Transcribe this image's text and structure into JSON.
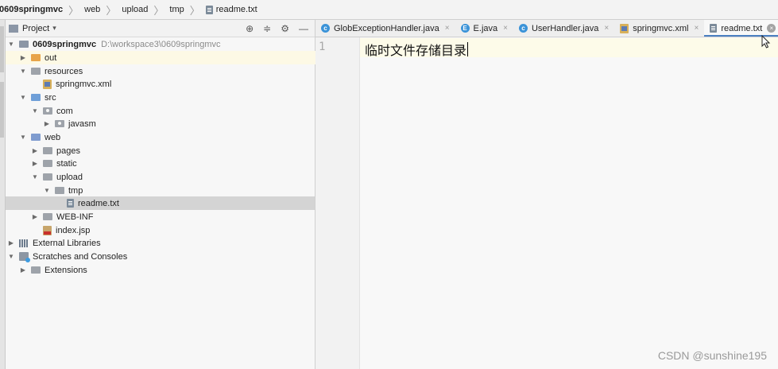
{
  "breadcrumb": [
    "0609springmvc",
    "web",
    "upload",
    "tmp",
    "readme.txt"
  ],
  "project_panel": {
    "title": "Project",
    "tree": [
      {
        "label": "0609springmvc",
        "path": "D:\\workspace3\\0609springmvc",
        "indent": 0,
        "expanded": true,
        "icon": "module-folder-icon",
        "bold": true
      },
      {
        "label": "out",
        "indent": 1,
        "expanded": false,
        "icon": "orange-folder-icon",
        "highlight": "yellow"
      },
      {
        "label": "resources",
        "indent": 1,
        "expanded": true,
        "icon": "resources-folder-icon"
      },
      {
        "label": "springmvc.xml",
        "indent": 2,
        "icon": "xml-file-icon"
      },
      {
        "label": "src",
        "indent": 1,
        "expanded": true,
        "icon": "source-folder-icon"
      },
      {
        "label": "com",
        "indent": 2,
        "expanded": true,
        "icon": "package-icon"
      },
      {
        "label": "javasm",
        "indent": 3,
        "expanded": false,
        "icon": "package-icon"
      },
      {
        "label": "web",
        "indent": 1,
        "expanded": true,
        "icon": "web-folder-icon"
      },
      {
        "label": "pages",
        "indent": 2,
        "expanded": false,
        "icon": "folder-icon"
      },
      {
        "label": "static",
        "indent": 2,
        "expanded": false,
        "icon": "folder-icon"
      },
      {
        "label": "upload",
        "indent": 2,
        "expanded": true,
        "icon": "folder-icon"
      },
      {
        "label": "tmp",
        "indent": 3,
        "expanded": true,
        "icon": "folder-icon"
      },
      {
        "label": "readme.txt",
        "indent": 4,
        "icon": "text-file-icon",
        "selected": true
      },
      {
        "label": "WEB-INF",
        "indent": 2,
        "expanded": false,
        "icon": "folder-icon"
      },
      {
        "label": "index.jsp",
        "indent": 2,
        "icon": "jsp-file-icon"
      },
      {
        "label": "External Libraries",
        "indent": 0,
        "expanded": false,
        "icon": "libraries-icon"
      },
      {
        "label": "Scratches and Consoles",
        "indent": 0,
        "expanded": true,
        "icon": "scratches-icon"
      },
      {
        "label": "Extensions",
        "indent": 1,
        "expanded": false,
        "icon": "folder-icon"
      }
    ]
  },
  "editor": {
    "tabs": [
      {
        "label": "GlobExceptionHandler.java",
        "icon": "class-icon",
        "letter": "c"
      },
      {
        "label": "E.java",
        "icon": "enum-icon",
        "letter": "E"
      },
      {
        "label": "UserHandler.java",
        "icon": "class-icon",
        "letter": "c"
      },
      {
        "label": "springmvc.xml",
        "icon": "xml-file-icon"
      },
      {
        "label": "readme.txt",
        "icon": "text-file-icon",
        "active": true
      }
    ],
    "line_number": "1",
    "content": "临时文件存储目录"
  },
  "watermark": "CSDN @sunshine195"
}
